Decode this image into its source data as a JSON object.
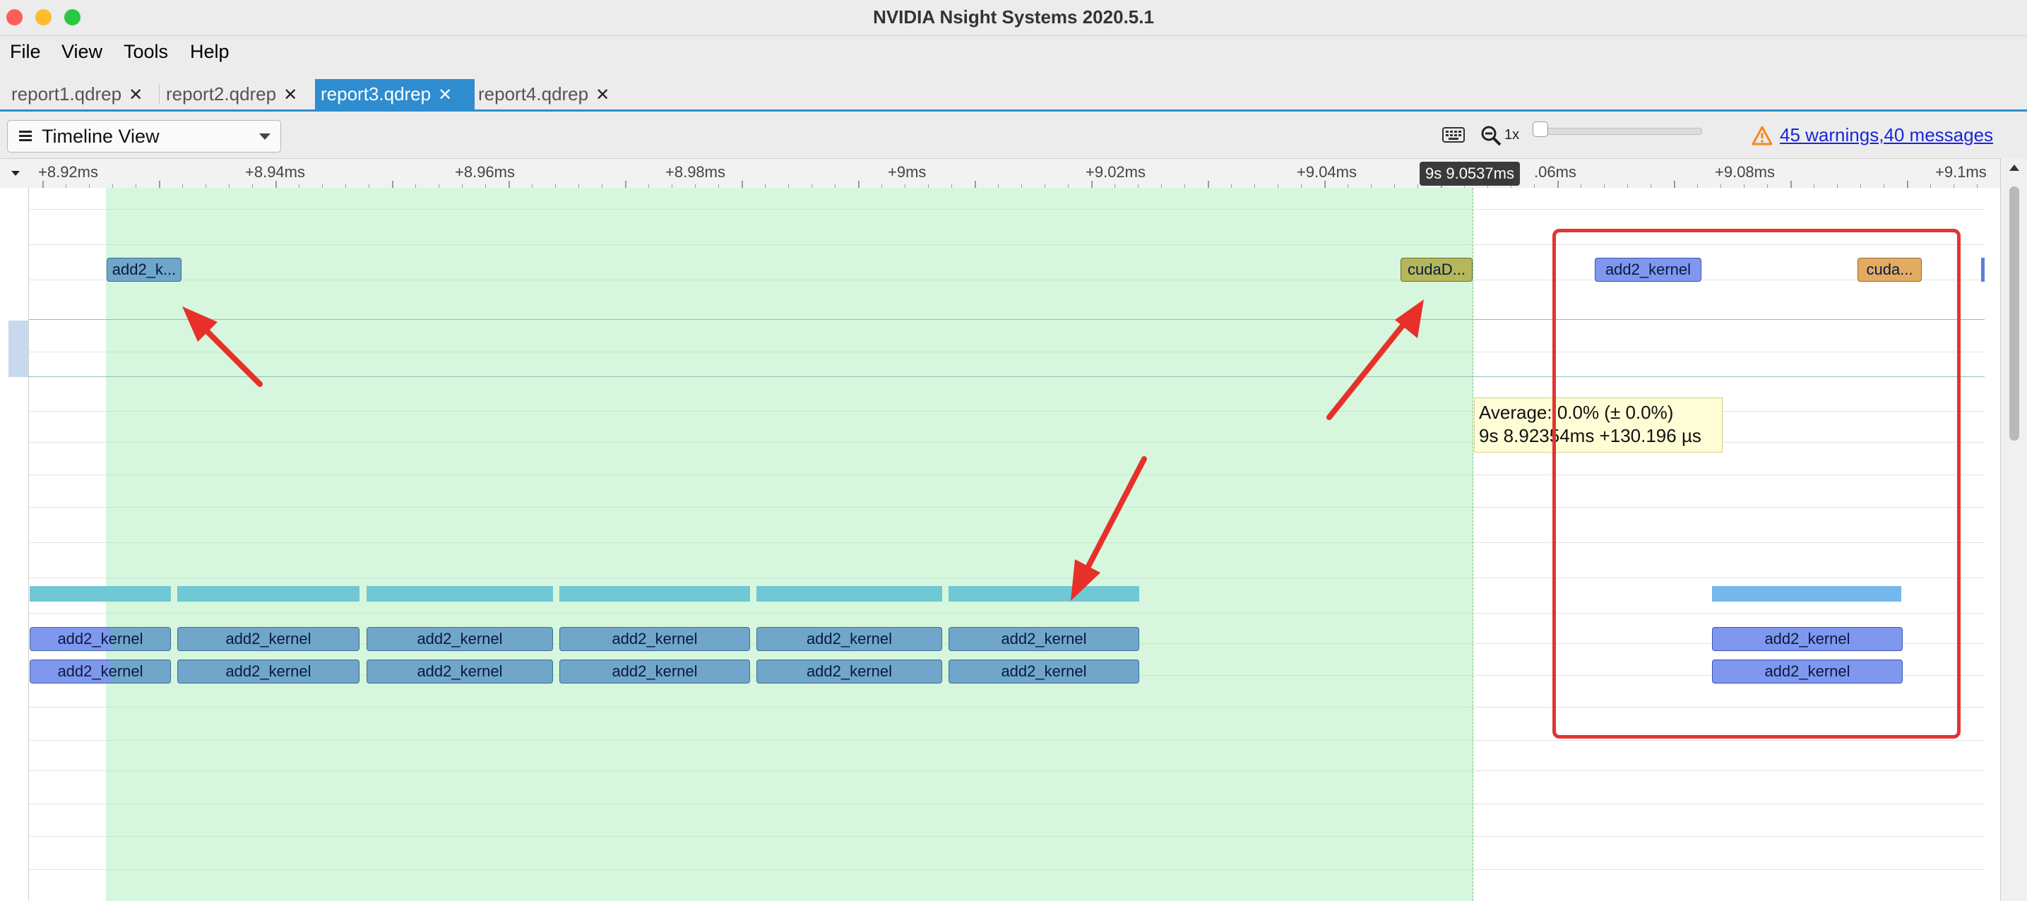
{
  "window": {
    "title": "NVIDIA Nsight Systems 2020.5.1"
  },
  "colors": {
    "close": "#fd5e57",
    "minimize": "#febc2e",
    "zoom": "#28c840",
    "accent": "#2e8ccf",
    "annotation": "#e23434"
  },
  "menu": [
    "File",
    "View",
    "Tools",
    "Help"
  ],
  "tabs": [
    {
      "label": "report1.qdrep",
      "active": false
    },
    {
      "label": "report2.qdrep",
      "active": false
    },
    {
      "label": "report3.qdrep",
      "active": true
    },
    {
      "label": "report4.qdrep",
      "active": false
    }
  ],
  "toolbar": {
    "view_select": "Timeline View",
    "zoom_level": "1x",
    "warnings_link": "45 warnings,40 messages",
    "icons": [
      "keyboard-icon",
      "zoom-out-icon",
      "warning-icon"
    ]
  },
  "ruler": {
    "ticks": [
      "+8.92ms",
      "+8.94ms",
      "+8.96ms",
      "+8.98ms",
      "+9ms",
      "+9.02ms",
      "+9.04ms",
      ".06ms",
      "+9.08ms",
      "+9.1ms"
    ],
    "cursor_time": "9s 9.0537ms"
  },
  "timeline": {
    "api_row": [
      "add2_k...",
      "cudaD...",
      "add2_kernel",
      "cuda..."
    ],
    "kernel_row_1": [
      "add2_kernel",
      "add2_kernel",
      "add2_kernel",
      "add2_kernel",
      "add2_kernel",
      "add2_kernel",
      "add2_kernel"
    ],
    "kernel_row_2": [
      "add2_kernel",
      "add2_kernel",
      "add2_kernel",
      "add2_kernel",
      "add2_kernel",
      "add2_kernel",
      "add2_kernel"
    ]
  },
  "tooltip": {
    "line1": "Average: 0.0% (± 0.0%)",
    "line2": "9s 8.92354ms +130.196 µs"
  }
}
